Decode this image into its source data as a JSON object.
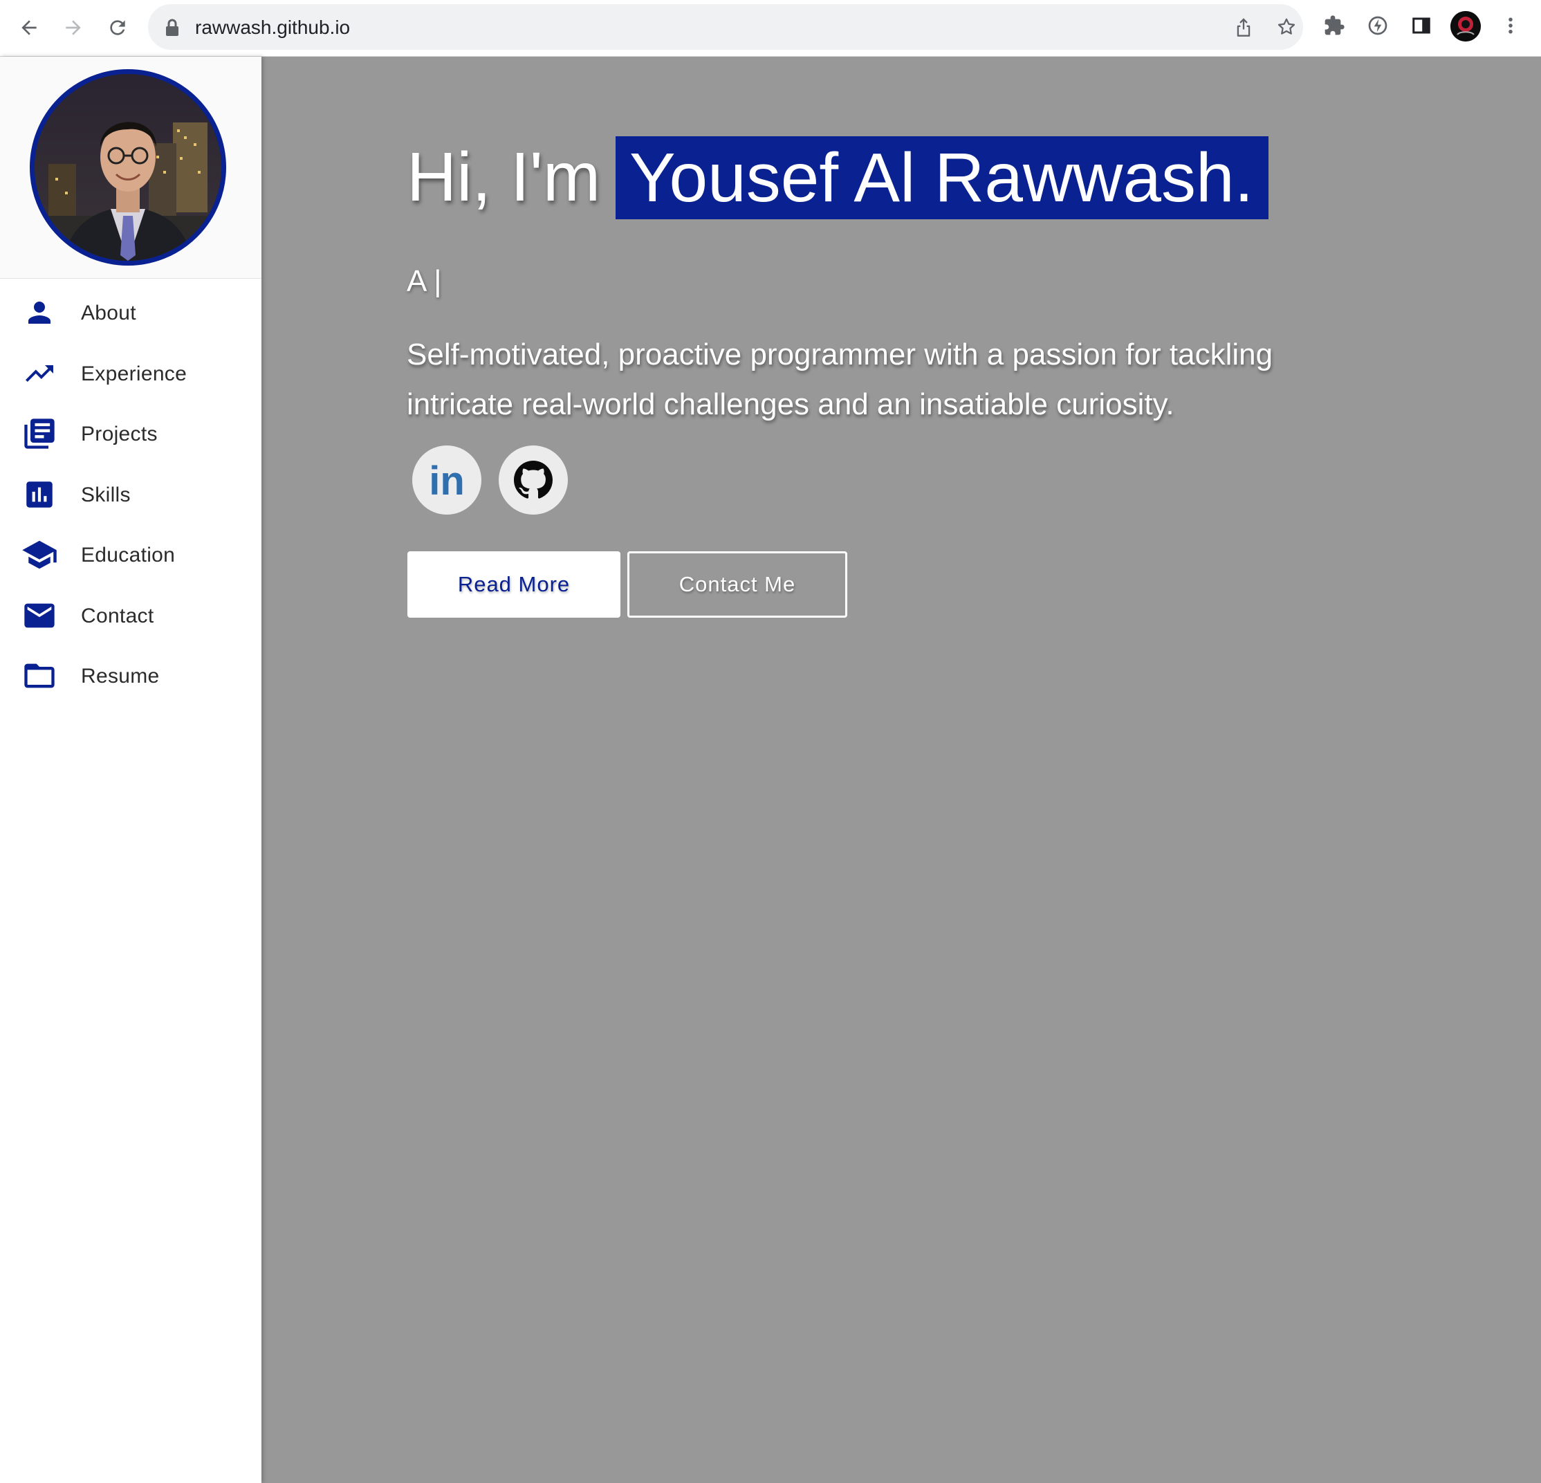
{
  "browser": {
    "url": "rawwash.github.io",
    "icons": [
      "back-icon",
      "forward-icon",
      "reload-icon",
      "lock-icon",
      "share-icon",
      "star-icon",
      "extensions-icon",
      "lightning-icon",
      "side-panel-icon",
      "profile-avatar",
      "more-icon"
    ]
  },
  "colors": {
    "accent": "#0a2291",
    "main_bg": "#989898",
    "sidebar_bg": "#ffffff"
  },
  "sidebar": {
    "items": [
      {
        "label": "About",
        "icon": "person-icon"
      },
      {
        "label": "Experience",
        "icon": "trending-up-icon"
      },
      {
        "label": "Projects",
        "icon": "library-books-icon"
      },
      {
        "label": "Skills",
        "icon": "bar-chart-icon"
      },
      {
        "label": "Education",
        "icon": "school-icon"
      },
      {
        "label": "Contact",
        "icon": "mail-icon"
      },
      {
        "label": "Resume",
        "icon": "folder-icon"
      }
    ]
  },
  "hero": {
    "greeting": "Hi, I'm",
    "name": "Yousef Al Rawwash.",
    "typed_text": "A |",
    "bio": "Self-motivated, proactive programmer with a passion for tackling intricate real-world challenges and an insatiable curiosity."
  },
  "social": {
    "linkedin_label": "in",
    "items": [
      "linkedin-icon",
      "github-icon"
    ]
  },
  "buttons": {
    "read_more": "Read More",
    "contact_me": "Contact Me"
  }
}
